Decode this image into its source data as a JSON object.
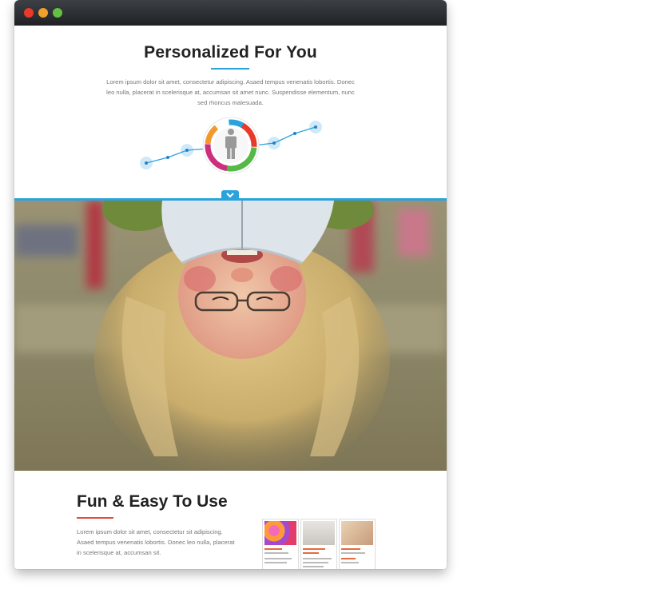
{
  "window": {
    "controls": [
      "close",
      "minimize",
      "maximize"
    ]
  },
  "hero": {
    "title": "Personalized For You",
    "description": "Lorem ipsum dolor sit amet, consectetur adipiscing. Asaed tempus venenatis lobortis. Donec leo nulla, placerat in scelerisque at, accumsan sit amet nunc. Suspendisse elementum, nunc sed rhoncus malesuada.",
    "accent_color": "#2aa3dd"
  },
  "feature": {
    "title": "Fun & Easy To Use",
    "description": "Lorem ipsum dolor sit amet, consectetur sit adipiscing. Asaed tempus venenatis lobortis. Donec leo nulla, placerat in scelerisque at, accumsan sit.",
    "accent_color": "#e84b3c"
  },
  "icons": {
    "person": "person-icon",
    "chevron": "chevron-down-icon"
  }
}
